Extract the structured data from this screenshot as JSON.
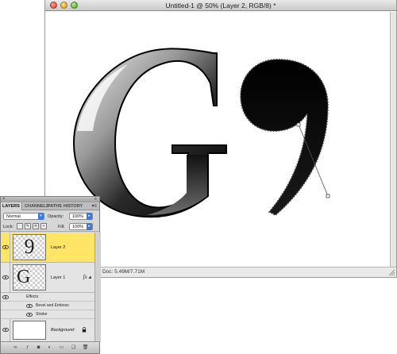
{
  "window": {
    "title": "Untitled-1 @ 50% (Layer 2, RGB/8) *",
    "status": "Doc: 5.49M/7.71M"
  },
  "canvas": {
    "glyph_letter": "G",
    "glyph_digit": "9"
  },
  "layers_panel": {
    "tabs": [
      {
        "label": "LAYERS",
        "active": true
      },
      {
        "label": "CHANNELS",
        "active": false
      },
      {
        "label": "PATHS",
        "active": false
      },
      {
        "label": "HISTORY",
        "active": false
      }
    ],
    "blend_mode": "Normal",
    "opacity_label": "Opacity:",
    "opacity_value": "100%",
    "lock_label": "Lock:",
    "fill_label": "Fill:",
    "fill_value": "100%",
    "layers": [
      {
        "name": "Layer 2",
        "thumb_glyph": "9",
        "selected": true
      },
      {
        "name": "Layer 1",
        "thumb_glyph": "G",
        "selected": false,
        "fx": "fx"
      },
      {
        "name": "Background",
        "selected": false
      }
    ],
    "effects_header": "Effects",
    "effects": [
      "Bevel and Emboss",
      "Stroke"
    ]
  },
  "colors": {
    "selected_layer": "#ffe566",
    "accent": "#3c79d8"
  }
}
